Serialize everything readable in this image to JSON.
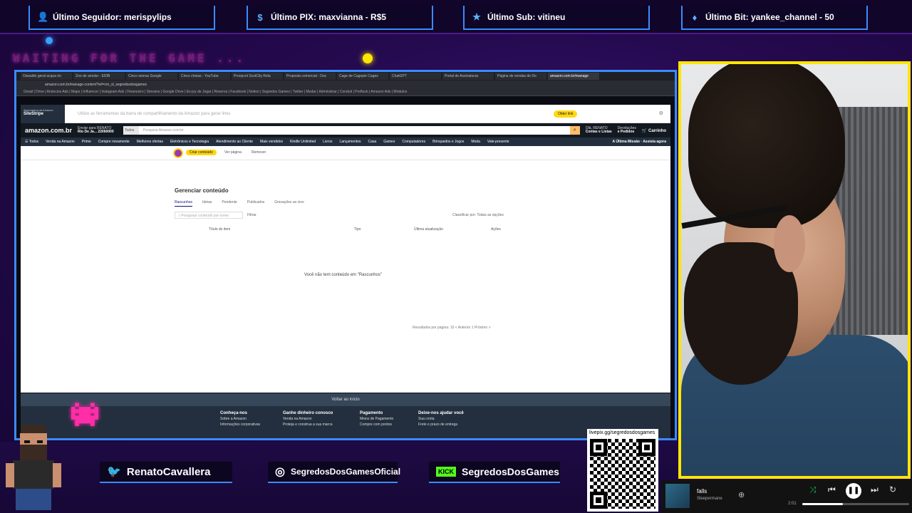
{
  "overlay": {
    "waiting_text": "WAITING FOR THE GAME ...",
    "alerts": [
      {
        "icon": "user-icon",
        "glyph": "👤",
        "text": "Último Seguidor: merispylips"
      },
      {
        "icon": "dollar-icon",
        "glyph": "$",
        "text": "Último PIX: maxvianna - R$5"
      },
      {
        "icon": "star-icon",
        "glyph": "★",
        "text": "Último Sub: vitineu"
      },
      {
        "icon": "diamond-icon",
        "glyph": "♦",
        "text": "Último Bit: yankee_channel - 50"
      }
    ],
    "socials": {
      "twitter": "RenatoCavallera",
      "instagram": "SegredosDosGamesOficial",
      "kick_badge": "KICK",
      "kick": "SegredosDosGames"
    },
    "qr_url": "livepix.gg/segredosdosgames",
    "accent_blue": "#3a8cff",
    "accent_yellow": "#ffe600"
  },
  "browser": {
    "tabs": [
      "Oswaldo geral acqua rio",
      "Zoo de amolar - EIDB",
      "Cinco seeras Google",
      "Cinco cheias - YouTube",
      "Pronpcnt ScotCity Rela",
      "Proposta comercial - Doc",
      "Cage de Cagepie Cages",
      "ChatGPT",
      "Portal de Assinaturas",
      "Página de vendas de Do",
      "amazon.com.br/manage"
    ],
    "url": "amazon.com.br/manage-content?ref=cm_sl_segredosdosgames",
    "bookmarks": "Gmail | Drive | Anúncios Ads | Maps | Influencer | Instagram Ads | Financeiro | Streams | Google Drive | Ex-joy de Jogar | Reserva | Facebook | Notion | Segredos Games | Twitter | Mudar | Administrar | Conduit | Preflush | Amazon Ads | Modulos"
  },
  "amazon": {
    "sitestripe_label": "Associados da Amazon",
    "sitestripe_name": "SiteStripe",
    "sitestripe_text": "Utilize as ferramentas da barra de compartilhamento da Amazon para gerar links",
    "sitestripe_button": "Obter link",
    "logo": "amazon.com.br",
    "deliver_line1": "Enviar para RENATO",
    "deliver_line2": "Rio De Ja... 22060000",
    "search_scope": "Todos",
    "search_placeholder": "Pesquisa Amazon.com.br",
    "account_line1": "Olá, RENATO",
    "account_line2": "Contas e Listas",
    "orders_line1": "Devoluções",
    "orders_line2": "e Pedidos",
    "cart": "Carrinho",
    "subnav": [
      "Todos",
      "Venda na Amazon",
      "Prime",
      "Compre novamente",
      "Melhores ofertas",
      "Eletrônicos e Tecnologia",
      "Atendimento ao Cliente",
      "Mais vendidos",
      "Kindle Unlimited",
      "Livros",
      "Lançamentos",
      "Casa",
      "Games",
      "Computadores",
      "Brinquedos e Jogos",
      "Moda",
      "Vale-presente"
    ],
    "promo": "A Última Missão · Assista agora",
    "creator_pill": "Criar conteúdo",
    "creator_links": [
      "Ver página",
      "Remover"
    ],
    "title": "Gerenciar conteúdo",
    "tabs": [
      "Rascunhos",
      "Ideias",
      "Pendente",
      "Publicados",
      "Gravações ao vivo"
    ],
    "search_content": "Pesquisar conteúdo por nome",
    "filter": "Filtrar",
    "sort": "Classificar por: Todas as opções",
    "columns": [
      "Título do item",
      "Tipo",
      "Última atualização",
      "Ações"
    ],
    "empty_msg": "Você não tem conteúdo em \"Rascunhos\"",
    "pager": "Resultados por página: 10     < Anterior     1     Próximo >",
    "back_to_top": "Voltar ao início",
    "footer": [
      {
        "head": "Conheça-nos",
        "items": [
          "Sobre a Amazon",
          "Informações corporativas"
        ]
      },
      {
        "head": "Ganhe dinheiro conosco",
        "items": [
          "Venda na Amazon",
          "Proteja e construa a sua marca"
        ]
      },
      {
        "head": "Pagamento",
        "items": [
          "Meios de Pagamento",
          "Compre com pontos"
        ]
      },
      {
        "head": "Deixe-nos ajudar você",
        "items": [
          "Sua conta",
          "Frete e prazo de entrega"
        ]
      }
    ]
  },
  "spotify": {
    "title": "falls",
    "artist": "Sleepermane",
    "time": "2:01",
    "progress": 0.38
  }
}
